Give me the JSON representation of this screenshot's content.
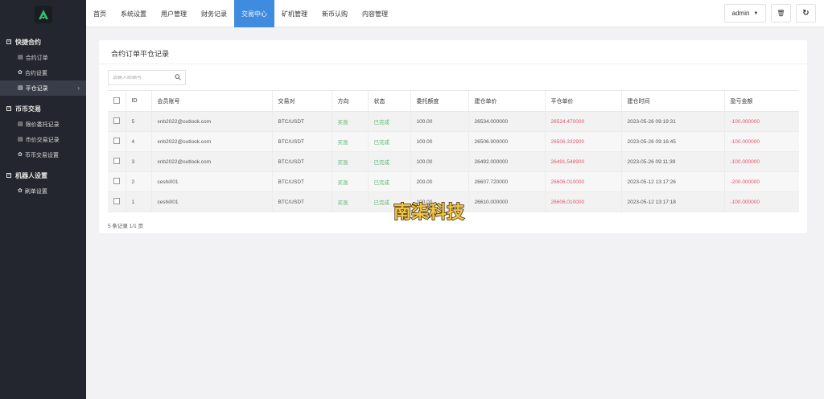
{
  "sidebar": {
    "groups": [
      {
        "label": "快捷合约",
        "items": [
          {
            "label": "合约订单",
            "icon": "list-icon"
          },
          {
            "label": "合约设置",
            "icon": "gear-icon"
          },
          {
            "label": "平仓记录",
            "icon": "list-icon",
            "active": true
          }
        ]
      },
      {
        "label": "币币交易",
        "items": [
          {
            "label": "限价委托记录",
            "icon": "list-icon"
          },
          {
            "label": "市价交易记录",
            "icon": "list-icon"
          },
          {
            "label": "币币交易设置",
            "icon": "gear-icon"
          }
        ]
      },
      {
        "label": "机器人设置",
        "items": [
          {
            "label": "刷单设置",
            "icon": "gear-icon"
          }
        ]
      }
    ],
    "active_arrow": "›"
  },
  "nav": {
    "items": [
      "首页",
      "系统设置",
      "用户管理",
      "财务记录",
      "交易中心",
      "矿机管理",
      "新币认购",
      "内容管理"
    ],
    "active_index": 4
  },
  "topright": {
    "admin_label": "admin",
    "admin_caret": "▼",
    "delete_glyph": "🗑",
    "refresh_glyph": "↻"
  },
  "panel": {
    "title": "合约订单平仓记录",
    "search_placeholder": "请输入邮箱号",
    "search_glyph": "⚲"
  },
  "table": {
    "headers": [
      "ID",
      "会员账号",
      "交易对",
      "方向",
      "状态",
      "委托额度",
      "建仓单价",
      "平仓单价",
      "建仓时间",
      "盈亏金额"
    ],
    "rows": [
      {
        "id": "5",
        "account": "xnb2022@outlook.com",
        "pair": "BTC/USDT",
        "direction": "买涨",
        "status": "已完成",
        "amount": "100.00",
        "open_price": "26534.000000",
        "close_price": "26524.470000",
        "open_time": "2023-05-26 09:19:31",
        "pnl": "-100.000000"
      },
      {
        "id": "4",
        "account": "xnb2022@outlook.com",
        "pair": "BTC/USDT",
        "direction": "买涨",
        "status": "已完成",
        "amount": "100.00",
        "open_price": "26506.900000",
        "close_price": "26506.332900",
        "open_time": "2023-05-26 09:16:45",
        "pnl": "-100.000000"
      },
      {
        "id": "3",
        "account": "xnb2022@outlook.com",
        "pair": "BTC/USDT",
        "direction": "买涨",
        "status": "已完成",
        "amount": "100.00",
        "open_price": "26492.000000",
        "close_price": "26491.548900",
        "open_time": "2023-05-26 09:11:39",
        "pnl": "-100.000000"
      },
      {
        "id": "2",
        "account": "ceshi001",
        "pair": "BTC/USDT",
        "direction": "买涨",
        "status": "已完成",
        "amount": "200.00",
        "open_price": "26607.720000",
        "close_price": "26606.010000",
        "open_time": "2023-05-12 13:17:26",
        "pnl": "-200.000000"
      },
      {
        "id": "1",
        "account": "ceshi001",
        "pair": "BTC/USDT",
        "direction": "买涨",
        "status": "已完成",
        "amount": "100.00",
        "open_price": "26610.000000",
        "close_price": "26606.010000",
        "open_time": "2023-05-12 13:17:18",
        "pnl": "-100.000000"
      }
    ],
    "footer": "5 条记录 1/1 页"
  },
  "watermark": {
    "text": "南柒科技"
  },
  "colors": {
    "sidebar_bg": "#23262e",
    "nav_active": "#3f8be0",
    "green": "#5fb878",
    "red": "#e0556f",
    "logo_accent": "#2ec26a"
  }
}
